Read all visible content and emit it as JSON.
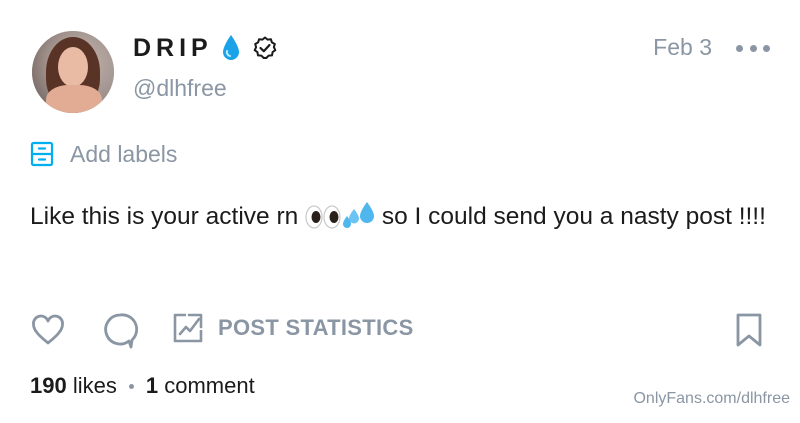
{
  "post": {
    "author": {
      "display_name": "DRIP",
      "handle": "@dlhfree",
      "name_emoji_icon": "droplet-icon",
      "badge_icon": "verified-icon"
    },
    "date": "Feb 3",
    "labels_text": "Add labels",
    "text_before": "Like this is your active rn ",
    "text_emojis": [
      "eyes-emoji",
      "sweat-droplets-emoji"
    ],
    "text_after": " so I could send you a nasty post !!!!",
    "actions": {
      "like_icon": "heart-icon",
      "comment_icon": "comment-bubble-icon",
      "stats_icon": "chart-icon",
      "stats_label": "POST STATISTICS",
      "bookmark_icon": "bookmark-icon"
    },
    "likes_count": "190",
    "likes_label": " likes",
    "comments_count": "1",
    "comments_label": " comment"
  },
  "watermark": "OnlyFans.com/dlhfree",
  "colors": {
    "text": "#1b1b1b",
    "muted": "#8a96a3",
    "accent": "#00aff0"
  }
}
